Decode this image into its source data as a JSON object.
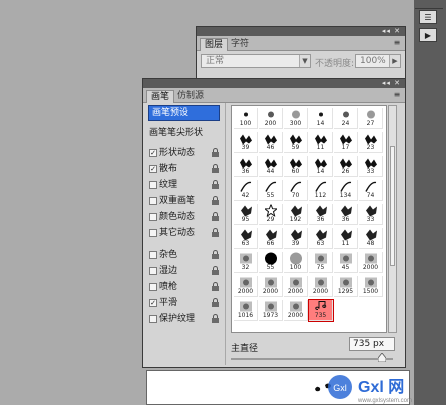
{
  "layers_panel": {
    "tabs": [
      "图层",
      "字符"
    ],
    "blend_mode": "正常",
    "opacity_label": "不透明度:",
    "opacity_value": "100%"
  },
  "brushes_panel": {
    "tabs": [
      "画笔",
      "仿制源"
    ],
    "preset_button": "画笔预设",
    "tip_shape": "画笔笔尖形状",
    "options": [
      {
        "label": "形状动态",
        "checked": true,
        "lock": true
      },
      {
        "label": "散布",
        "checked": true,
        "lock": true
      },
      {
        "label": "纹理",
        "checked": false,
        "lock": true
      },
      {
        "label": "双重画笔",
        "checked": false,
        "lock": true
      },
      {
        "label": "颜色动态",
        "checked": false,
        "lock": true
      },
      {
        "label": "其它动态",
        "checked": false,
        "lock": true
      },
      {
        "label": "杂色",
        "checked": false,
        "lock": true
      },
      {
        "label": "湿边",
        "checked": false,
        "lock": true
      },
      {
        "label": "喷枪",
        "checked": false,
        "lock": true
      },
      {
        "label": "平滑",
        "checked": true,
        "lock": true
      },
      {
        "label": "保护纹理",
        "checked": false,
        "lock": true
      }
    ],
    "grid": [
      [
        "100",
        "200",
        "300",
        "14",
        "24",
        "27"
      ],
      [
        "39",
        "46",
        "59",
        "11",
        "17",
        "23"
      ],
      [
        "36",
        "44",
        "60",
        "14",
        "26",
        "33"
      ],
      [
        "42",
        "55",
        "70",
        "112",
        "134",
        "74"
      ],
      [
        "95",
        "29",
        "192",
        "36",
        "36",
        "33"
      ],
      [
        "63",
        "66",
        "39",
        "63",
        "11",
        "48"
      ],
      [
        "32",
        "55",
        "100",
        "75",
        "45",
        "2000"
      ],
      [
        "2000",
        "2000",
        "2000",
        "2000",
        "1295",
        "1500"
      ],
      [
        "1016",
        "1973",
        "2000",
        "735",
        "",
        ""
      ]
    ],
    "selected_brush": "735",
    "size_label": "主直径",
    "size_value": "735 px",
    "size_fraction": 0.93
  },
  "watermark": {
    "text": "Gxl 网",
    "url": "www.gxlsystem.com"
  },
  "colors": {
    "panel_bg": "#d4d4d4",
    "selected": "#ff7d7d",
    "highlight": "#2f6edc",
    "watermark": "#2e6bd6"
  }
}
